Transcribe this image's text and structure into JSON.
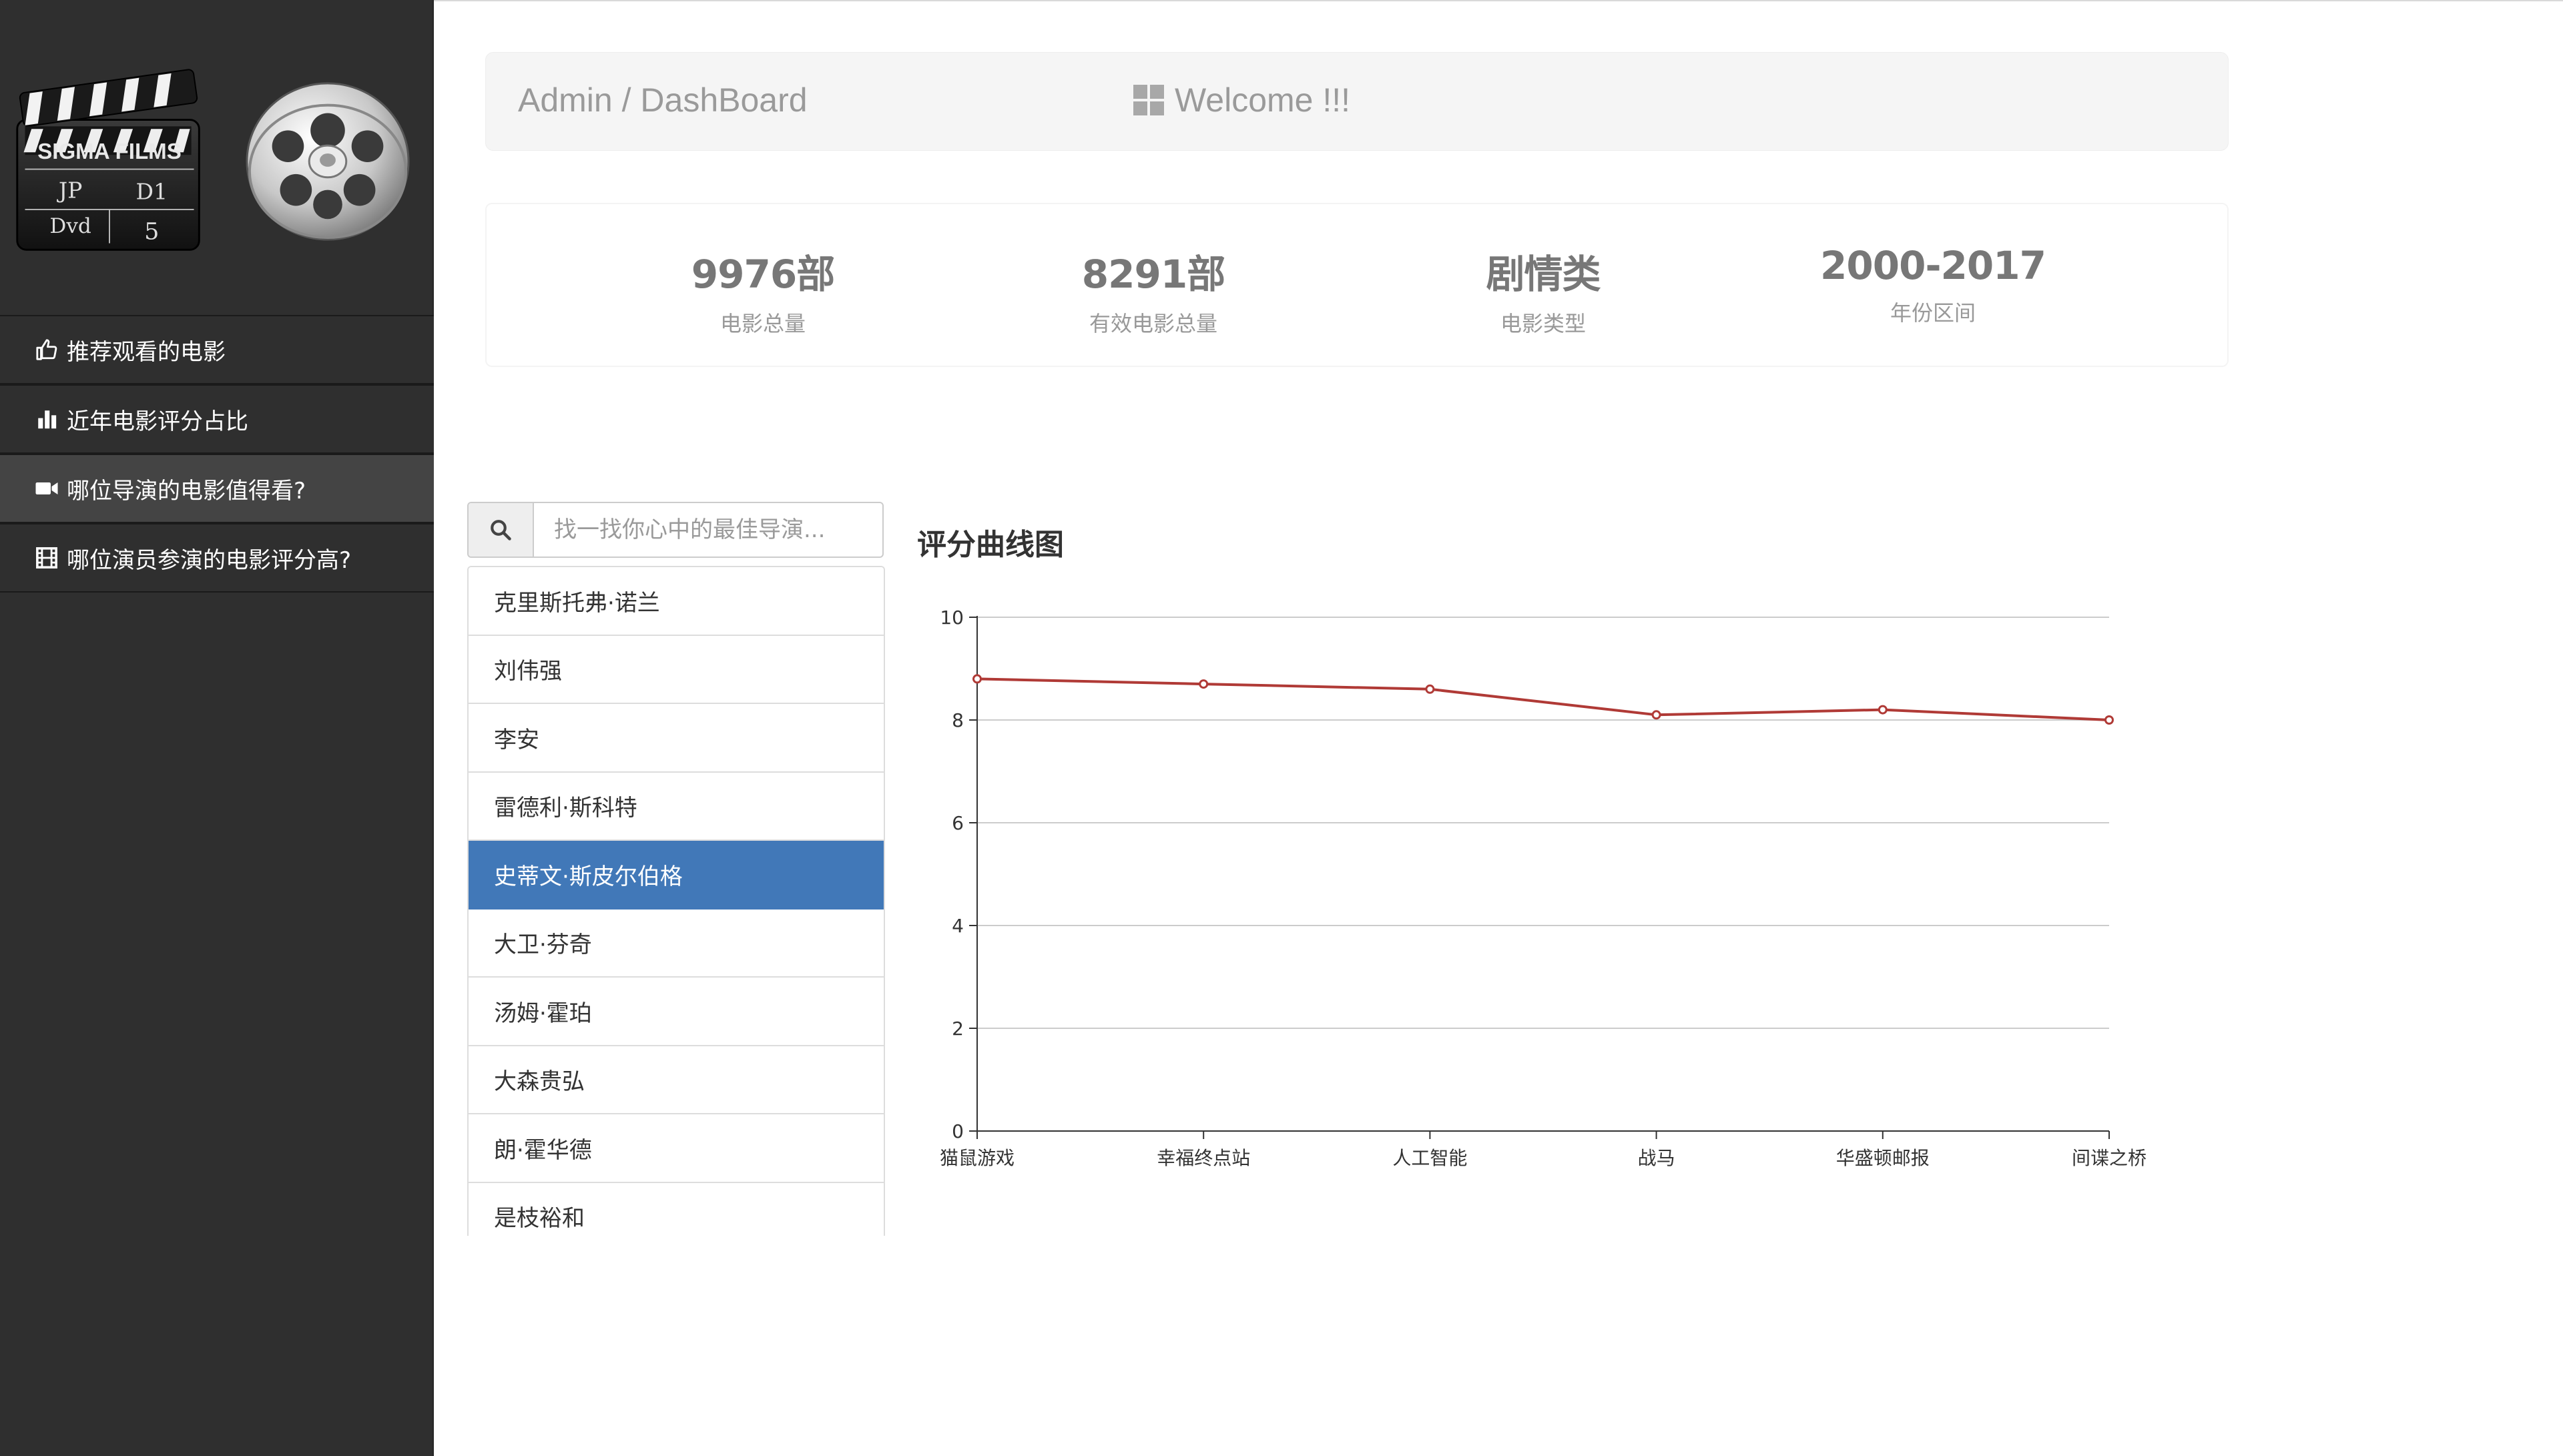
{
  "sidebar": {
    "logo_text": "SIGMA FILMS",
    "items": [
      {
        "label": "推荐观看的电影",
        "icon": "thumbs-up-icon"
      },
      {
        "label": "近年电影评分占比",
        "icon": "bar-chart-icon"
      },
      {
        "label": "哪位导演的电影值得看?",
        "icon": "video-camera-icon"
      },
      {
        "label": "哪位演员参演的电影评分高?",
        "icon": "film-icon"
      }
    ]
  },
  "header": {
    "breadcrumb": "Admin / DashBoard",
    "welcome": "Welcome !!!"
  },
  "stats": [
    {
      "value": "9976部",
      "label": "电影总量"
    },
    {
      "value": "8291部",
      "label": "有效电影总量"
    },
    {
      "value": "剧情类",
      "label": "电影类型"
    },
    {
      "value": "2000-2017",
      "label": "年份区间"
    }
  ],
  "search": {
    "placeholder": "找一找你心中的最佳导演..."
  },
  "directors": [
    "克里斯托弗·诺兰",
    "刘伟强",
    "李安",
    "雷德利·斯科特",
    "史蒂文·斯皮尔伯格",
    "大卫·芬奇",
    "汤姆·霍珀",
    "大森贵弘",
    "朗·霍华德",
    "是枝裕和"
  ],
  "selected_director_index": 4,
  "chart_title": "评分曲线图",
  "colors": {
    "sidebar_bg": "#2f2f2f",
    "selected": "#4178b8",
    "line": "#b03a36"
  },
  "chart_data": {
    "type": "line",
    "title": "评分曲线图",
    "categories": [
      "猫鼠游戏",
      "幸福终点站",
      "人工智能",
      "战马",
      "华盛顿邮报",
      "间谍之桥"
    ],
    "series": [
      {
        "values": [
          8.8,
          8.7,
          8.6,
          8.1,
          8.2,
          8.0
        ]
      }
    ],
    "ylim": [
      0,
      10
    ],
    "yticks": [
      0,
      2,
      4,
      6,
      8,
      10
    ],
    "grid": true,
    "xlabel": "",
    "ylabel": ""
  }
}
